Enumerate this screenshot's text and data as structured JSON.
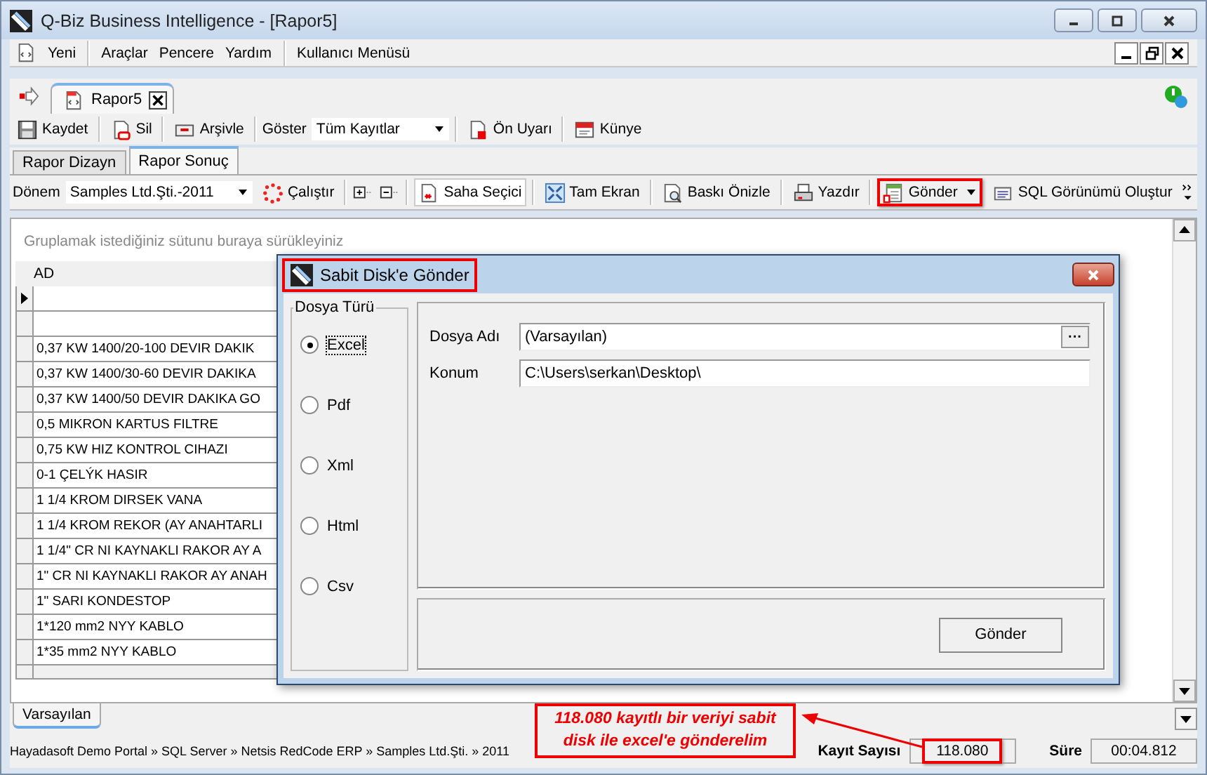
{
  "window": {
    "title": "Q-Biz Business Intelligence - [Rapor5]"
  },
  "menu": [
    "Yeni",
    "Araçlar",
    "Pencere",
    "Yardım",
    "Kullanıcı Menüsü"
  ],
  "doc_tabs": [
    {
      "label": "Rapor5",
      "selected": true
    }
  ],
  "toolbar": [
    {
      "kind": "button",
      "label": "Kaydet"
    },
    {
      "kind": "button",
      "label": "Sil"
    },
    {
      "kind": "button",
      "label": "Arşivle"
    },
    {
      "kind": "dropdown",
      "label": "Göster",
      "value": "Tüm Kayıtlar"
    },
    {
      "kind": "button",
      "label": "Ön Uyarı"
    },
    {
      "kind": "button",
      "label": "Künye"
    }
  ],
  "view_tabs": [
    {
      "label": "Rapor Dizayn",
      "selected": false
    },
    {
      "label": "Rapor Sonuç",
      "selected": true
    }
  ],
  "report_toolbar": [
    {
      "kind": "dropdown",
      "label": "Dönem",
      "value": "Samples Ltd.Şti.-2011"
    },
    {
      "kind": "button",
      "label": "Çalıştır"
    },
    {
      "kind": "expand"
    },
    {
      "kind": "button",
      "label": "Saha Seçici",
      "pressed": true
    },
    {
      "kind": "button",
      "label": "Tam Ekran",
      "pressed": false
    },
    {
      "kind": "button",
      "label": "Baskı Önizle",
      "pressed": false
    },
    {
      "kind": "button",
      "label": "Yazdır",
      "pressed": false
    },
    {
      "kind": "menu",
      "label": "Gönder",
      "highlighted": true
    },
    {
      "kind": "button",
      "label": "SQL Görünümü Oluştur",
      "pressed": false
    }
  ],
  "grid": {
    "group_hint": "Gruplamak istediğiniz sütunu buraya sürükleyiniz",
    "columns": [
      "AD"
    ],
    "rows": [
      {
        "current": true
      },
      {
        "current": false
      },
      {
        "text": "0,37 KW 1400/20-100 DEVIR DAKIK",
        "current": false
      },
      {
        "text": "0,37 KW 1400/30-60 DEVIR DAKIKA",
        "current": false
      },
      {
        "text": "0,37 KW 1400/50 DEVIR DAKIKA GO",
        "current": false
      },
      {
        "text": "0,5 MIKRON KARTUS FILTRE",
        "current": false
      },
      {
        "text": "0,75 KW HIZ KONTROL CIHAZI",
        "current": false
      },
      {
        "text": "0-1 ÇELÝK HASIR",
        "current": false
      },
      {
        "text": "1 1/4 KROM DIRSEK VANA",
        "current": false
      },
      {
        "text": "1 1/4 KROM REKOR (AY ANAHTARLI",
        "current": false
      },
      {
        "text": "1 1/4\" CR NI KAYNAKLI RAKOR AY A",
        "current": false
      },
      {
        "text": "1\" CR NI KAYNAKLI RAKOR AY ANAH",
        "current": false
      },
      {
        "text": "1\" SARI KONDESTOP",
        "current": false
      },
      {
        "text": "1*120 mm2 NYY KABLO",
        "current": false
      },
      {
        "text": "1*35 mm2 NYY KABLO",
        "current": false
      }
    ]
  },
  "layout_tabs": [
    {
      "label": "Varsayılan",
      "selected": true
    }
  ],
  "status_bar": {
    "path": "Hayadasoft Demo Portal » SQL Server » Netsis RedCode ERP » Samples Ltd.Şti. » 2011",
    "count_label": "Kayıt Sayısı",
    "count": "118.080",
    "count_highlighted": true,
    "time_label": "Süre",
    "time": "00:04.812"
  },
  "dialog": {
    "title": "Sabit Disk'e Gönder",
    "title_highlighted": true,
    "group_label": "Dosya Türü",
    "formats": [
      {
        "label": "Excel",
        "selected": true
      },
      {
        "label": "Pdf",
        "selected": false
      },
      {
        "label": "Xml",
        "selected": false
      },
      {
        "label": "Html",
        "selected": false
      },
      {
        "label": "Csv",
        "selected": false
      }
    ],
    "fields": [
      {
        "label": "Dosya Adı",
        "value": "(Varsayılan)",
        "browse": "···"
      },
      {
        "label": "Konum",
        "value": "C:\\Users\\serkan\\Desktop\\"
      }
    ],
    "button": "Gönder"
  },
  "callout": {
    "text": "118.080 kayıtlı bir veriyi sabit disk ile excel'e gönderelim"
  }
}
